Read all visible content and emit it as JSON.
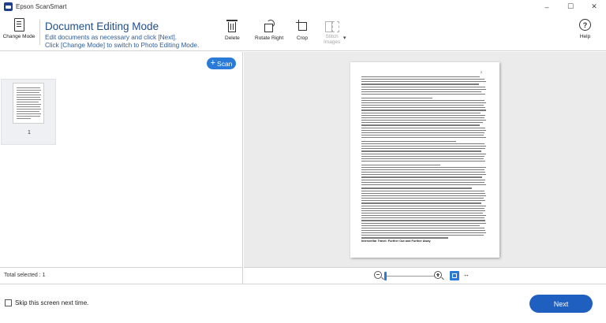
{
  "window": {
    "title": "Epson ScanSmart",
    "controls": {
      "minimize": "–",
      "maximize": "☐",
      "close": "✕"
    }
  },
  "toolbar": {
    "change_mode_label": "Change Mode",
    "mode_title": "Document Editing Mode",
    "mode_desc_line1": "Edit documents as necessary and click [Next].",
    "mode_desc_line2": "Click [Change Mode] to switch to Photo Editing Mode.",
    "delete_label": "Delete",
    "rotate_right_label": "Rotate Right",
    "crop_label": "Crop",
    "stitch_label_line1": "Stitch",
    "stitch_label_line2": "Images",
    "stitch_caret": "▾",
    "help_label": "Help",
    "help_glyph": "?"
  },
  "left_panel": {
    "scan_button_plus": "+",
    "scan_button_label": "Scan",
    "thumbnails": [
      {
        "page_number": "1",
        "selected": false
      }
    ],
    "total_selected": "Total selected : 1"
  },
  "preview": {
    "page_number": "2",
    "section_heading": "Interstellar Travel: Further Out and Further Away",
    "fit_width_glyph": "↔"
  },
  "footer": {
    "skip_label": "Skip this screen next time.",
    "skip_checked": false,
    "next_label": "Next"
  },
  "colors": {
    "accent": "#2a7ad8",
    "next_button": "#1f5fbf",
    "mode_title": "#1f4e8c",
    "preview_bg": "#ebebeb"
  }
}
